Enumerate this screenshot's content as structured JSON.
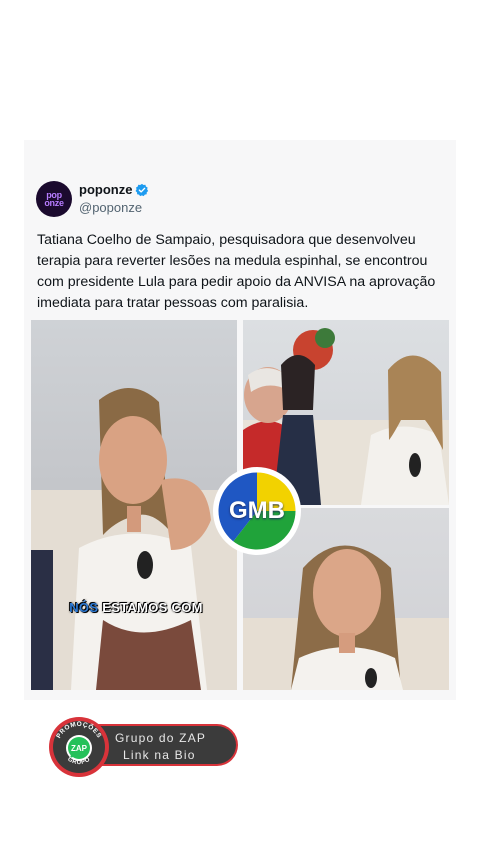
{
  "post": {
    "author_name": "poponze",
    "author_handle": "@poponze",
    "avatar_text_top": "pop",
    "avatar_text_bottom": "onze",
    "text": "Tatiana Coelho de Sampaio, pesquisadora que desenvolveu terapia para reverter lesões na medula espinhal, se encontrou com presidente Lula para pedir apoio da ANVISA na aprovação imediata para tratar pessoas com paralisia."
  },
  "media": {
    "caption_highlight": "NÓS",
    "caption_rest": "ESTAMOS COM",
    "watermark": "GMB"
  },
  "promo": {
    "line1": "Grupo do ZAP",
    "line2": "Link na Bio",
    "badge_center": "ZAP",
    "badge_ring_top": "PROMOÇÕES",
    "badge_ring_bottom": "GRUPO"
  },
  "colors": {
    "verified": "#1d9bf0",
    "handle": "#536471",
    "gmb_blue": "#1f57c3",
    "gmb_green": "#20a33a",
    "gmb_yellow": "#f2d200",
    "promo_red": "#d8333a",
    "zap_green": "#25c15a"
  }
}
